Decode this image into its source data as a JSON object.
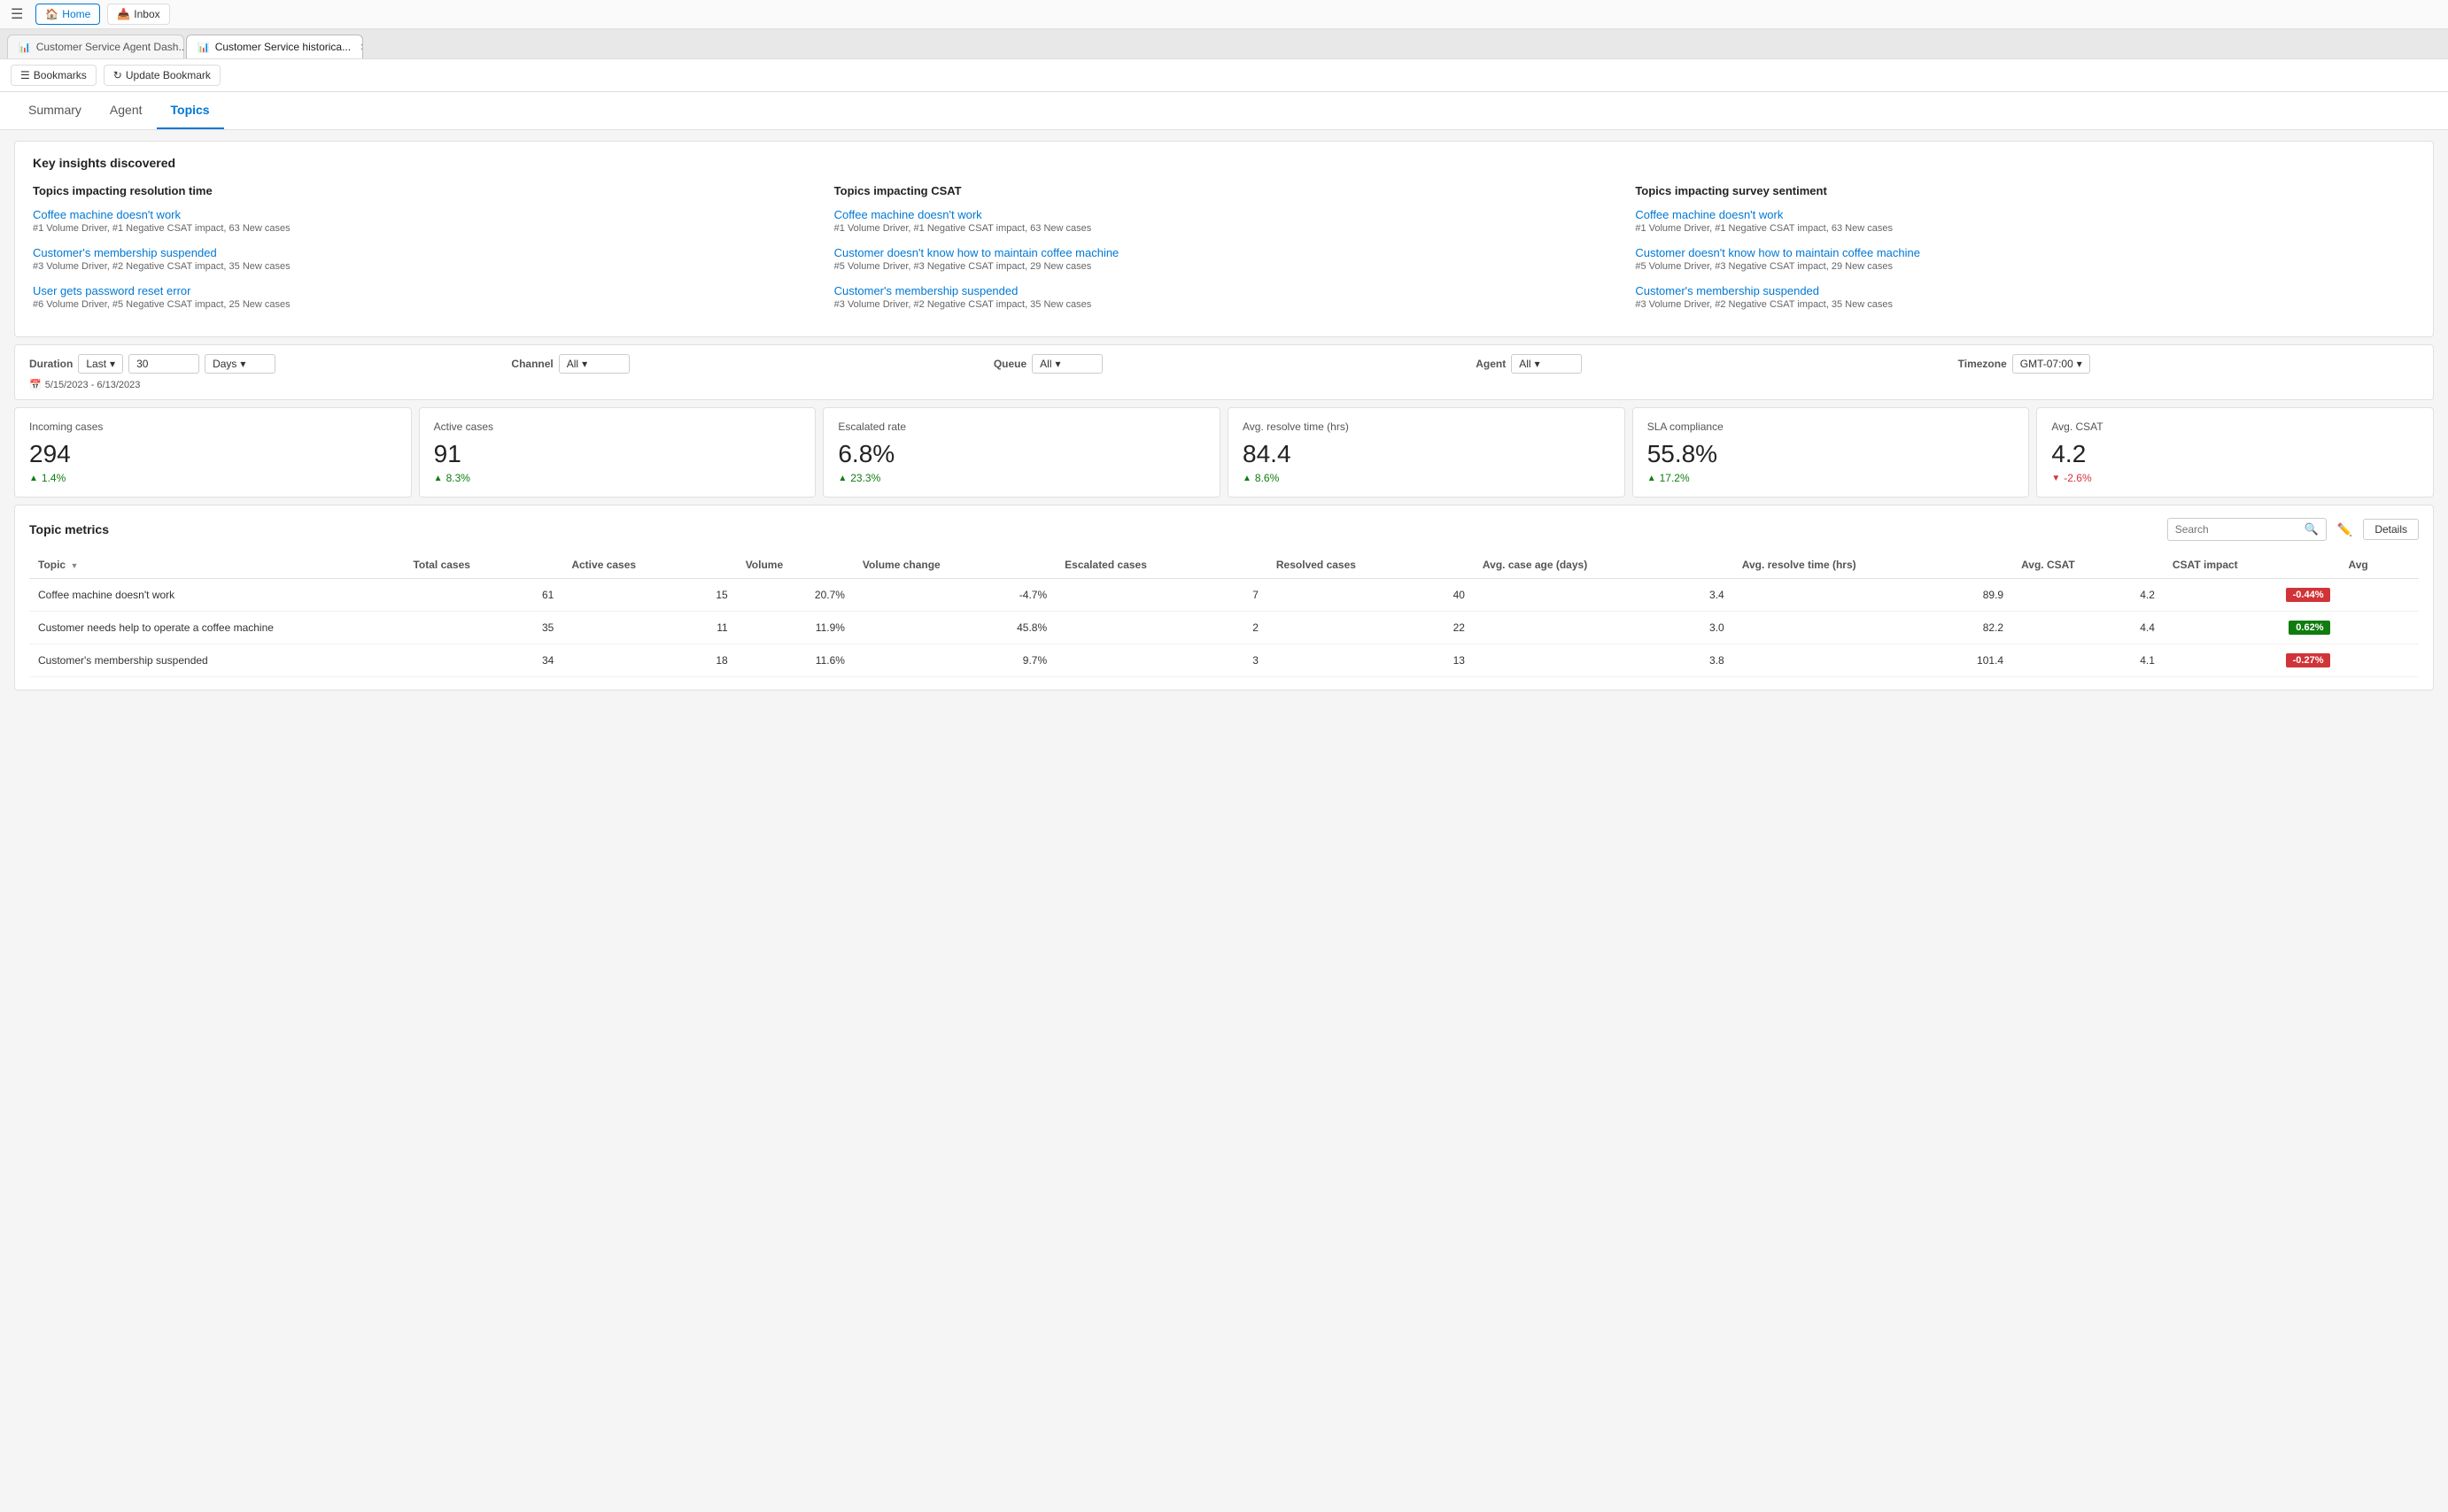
{
  "browser": {
    "tabs": [
      {
        "id": "tab1",
        "label": "Customer Service Agent Dash...",
        "icon": "📊",
        "active": false
      },
      {
        "id": "tab2",
        "label": "Customer Service historica...",
        "icon": "📊",
        "active": true
      }
    ]
  },
  "app_bar": {
    "home_label": "Home",
    "inbox_label": "Inbox",
    "bookmarks_label": "Bookmarks",
    "update_bookmark_label": "Update Bookmark"
  },
  "nav": {
    "items": [
      {
        "id": "summary",
        "label": "Summary",
        "active": false
      },
      {
        "id": "agent",
        "label": "Agent",
        "active": false
      },
      {
        "id": "topics",
        "label": "Topics",
        "active": true
      }
    ]
  },
  "key_insights": {
    "title": "Key insights discovered",
    "columns": [
      {
        "title": "Topics impacting resolution time",
        "items": [
          {
            "link": "Coffee machine doesn't work",
            "meta": "#1 Volume Driver, #1 Negative CSAT impact, 63 New cases"
          },
          {
            "link": "Customer's membership suspended",
            "meta": "#3 Volume Driver, #2 Negative CSAT impact, 35 New cases"
          },
          {
            "link": "User gets password reset error",
            "meta": "#6 Volume Driver, #5 Negative CSAT impact, 25 New cases"
          }
        ]
      },
      {
        "title": "Topics impacting CSAT",
        "items": [
          {
            "link": "Coffee machine doesn't work",
            "meta": "#1 Volume Driver, #1 Negative CSAT impact, 63 New cases"
          },
          {
            "link": "Customer doesn't know how to maintain coffee machine",
            "meta": "#5 Volume Driver, #3 Negative CSAT impact, 29 New cases"
          },
          {
            "link": "Customer's membership suspended",
            "meta": "#3 Volume Driver, #2 Negative CSAT impact, 35 New cases"
          }
        ]
      },
      {
        "title": "Topics impacting survey sentiment",
        "items": [
          {
            "link": "Coffee machine doesn't work",
            "meta": "#1 Volume Driver, #1 Negative CSAT impact, 63 New cases"
          },
          {
            "link": "Customer doesn't know how to maintain coffee machine",
            "meta": "#5 Volume Driver, #3 Negative CSAT impact, 29 New cases"
          },
          {
            "link": "Customer's membership suspended",
            "meta": "#3 Volume Driver, #2 Negative CSAT impact, 35 New cases"
          }
        ]
      }
    ]
  },
  "filters": {
    "duration_label": "Duration",
    "duration_value": "Last",
    "duration_number": "30",
    "duration_unit": "Days",
    "channel_label": "Channel",
    "channel_value": "All",
    "queue_label": "Queue",
    "queue_value": "All",
    "agent_label": "Agent",
    "agent_value": "All",
    "timezone_label": "Timezone",
    "timezone_value": "GMT-07:00",
    "date_range": "5/15/2023 - 6/13/2023"
  },
  "kpis": [
    {
      "id": "incoming",
      "label": "Incoming cases",
      "value": "294",
      "change": "1.4%",
      "direction": "up"
    },
    {
      "id": "active",
      "label": "Active cases",
      "value": "91",
      "change": "8.3%",
      "direction": "up"
    },
    {
      "id": "escalated",
      "label": "Escalated rate",
      "value": "6.8%",
      "change": "23.3%",
      "direction": "up"
    },
    {
      "id": "resolve",
      "label": "Avg. resolve time (hrs)",
      "value": "84.4",
      "change": "8.6%",
      "direction": "up"
    },
    {
      "id": "sla",
      "label": "SLA compliance",
      "value": "55.8%",
      "change": "17.2%",
      "direction": "up"
    },
    {
      "id": "csat",
      "label": "Avg. CSAT",
      "value": "4.2",
      "change": "-2.6%",
      "direction": "down"
    }
  ],
  "topic_metrics": {
    "title": "Topic metrics",
    "search_placeholder": "Search",
    "details_label": "Details",
    "columns": [
      "Topic",
      "Total cases",
      "Active cases",
      "Volume",
      "Volume change",
      "Escalated cases",
      "Resolved cases",
      "Avg. case age (days)",
      "Avg. resolve time (hrs)",
      "Avg. CSAT",
      "CSAT impact",
      "Avg"
    ],
    "rows": [
      {
        "topic": "Coffee machine doesn't work",
        "total_cases": "61",
        "active_cases": "15",
        "volume": "20.7%",
        "volume_change": "-4.7%",
        "escalated_cases": "7",
        "resolved_cases": "40",
        "avg_case_age": "3.4",
        "avg_resolve_time": "89.9",
        "avg_csat": "4.2",
        "csat_impact_val": "-0.44%",
        "csat_impact_color": "red"
      },
      {
        "topic": "Customer needs help to operate a coffee machine",
        "total_cases": "35",
        "active_cases": "11",
        "volume": "11.9%",
        "volume_change": "45.8%",
        "escalated_cases": "2",
        "resolved_cases": "22",
        "avg_case_age": "3.0",
        "avg_resolve_time": "82.2",
        "avg_csat": "4.4",
        "csat_impact_val": "0.62%",
        "csat_impact_color": "green"
      },
      {
        "topic": "Customer's membership suspended",
        "total_cases": "34",
        "active_cases": "18",
        "volume": "11.6%",
        "volume_change": "9.7%",
        "escalated_cases": "3",
        "resolved_cases": "13",
        "avg_case_age": "3.8",
        "avg_resolve_time": "101.4",
        "avg_csat": "4.1",
        "csat_impact_val": "-0.27%",
        "csat_impact_color": "red"
      }
    ]
  }
}
